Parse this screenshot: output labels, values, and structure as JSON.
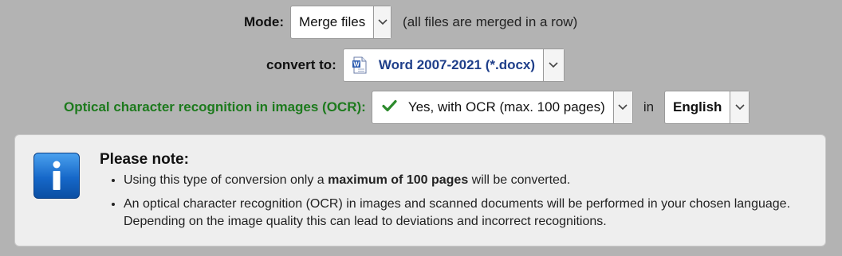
{
  "mode": {
    "label": "Mode:",
    "value": "Merge files",
    "hint": "(all files are merged in a row)"
  },
  "convert": {
    "label": "convert to:",
    "value": "Word 2007-2021 (*.docx)",
    "icon": "word-document-icon",
    "value_color": "#1f3f8a"
  },
  "ocr": {
    "label": "Optical character recognition in images (OCR):",
    "value": "Yes, with OCR (max. 100 pages)",
    "in_label": "in",
    "language": "English",
    "label_color": "#1d7a1d",
    "check_color": "#2c8a2c"
  },
  "note": {
    "title": "Please note:",
    "item1_prefix": "Using this type of conversion only a ",
    "item1_bold": "maximum of 100 pages",
    "item1_suffix": " will be converted.",
    "item2": "An optical character recognition (OCR) in images and scanned documents will be performed in your chosen language. Depending on the image quality this can lead to deviations and incorrect recognitions."
  }
}
